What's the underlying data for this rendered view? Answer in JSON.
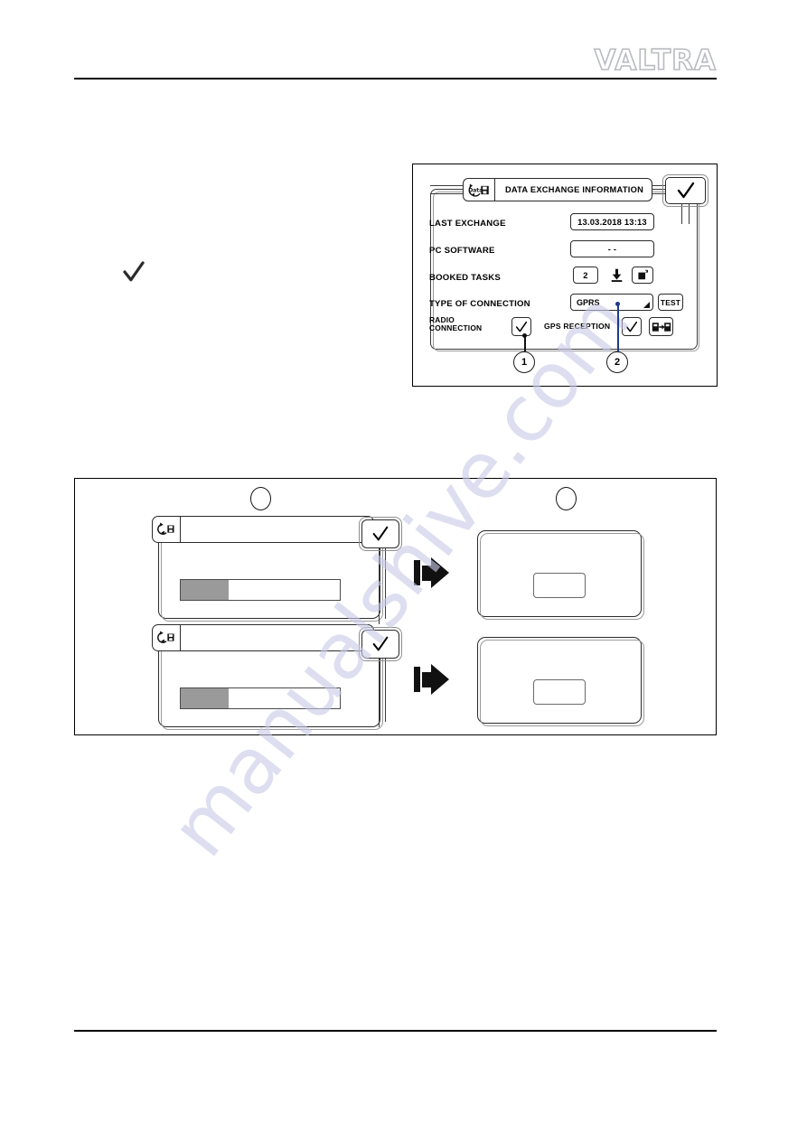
{
  "page": {
    "brand": "VALTRA",
    "brand_parts": {
      "v": "V",
      "a1": "A",
      "l": "L",
      "t": "T",
      "r": "R",
      "a2": "A"
    }
  },
  "figure1": {
    "title": "DATA EXCHANGE INFORMATION",
    "title_icon": "data-exchange-icon",
    "title_icon_label": "Data",
    "confirm_icon": "check-icon",
    "rows": [
      {
        "label": "LAST EXCHANGE",
        "value": "13.03.2018  13:13"
      },
      {
        "label": "PC SOFTWARE",
        "value": "- -"
      },
      {
        "label": "BOOKED TASKS",
        "value": "2"
      },
      {
        "label": "TYPE OF CONNECTION",
        "value": "GPRS"
      }
    ],
    "booked_tasks": {
      "count": "2",
      "download_icon": "download-icon",
      "delete_icon": "delete-icon"
    },
    "connection": {
      "selected": "GPRS",
      "options": [
        "GPRS"
      ],
      "test_label": "TEST",
      "dropdown_icon": "chevron-corner-icon"
    },
    "radio_connection": {
      "label_line1": "RADIO",
      "label_line2": "CONNECTION",
      "icon": "check-icon"
    },
    "gps_reception": {
      "label": "GPS RECEPTION",
      "icon": "check-icon",
      "transfer_icon": "data-transfer-icon"
    },
    "callouts": [
      {
        "number": "1"
      },
      {
        "number": "2"
      }
    ]
  },
  "figure2": {
    "step_markers": [
      "",
      ""
    ],
    "rows": [
      {
        "panel_icon": "sync-icon",
        "progress_percent": 30,
        "confirm_icon": "check-icon",
        "arrow_icon": "arrow-right-icon",
        "result_icon": "empty-field-icon"
      },
      {
        "panel_icon": "sync-icon",
        "progress_percent": 30,
        "confirm_icon": "check-icon",
        "arrow_icon": "arrow-right-icon",
        "result_icon": "empty-field-icon"
      }
    ]
  },
  "watermark": {
    "text": "manualshive.com"
  },
  "colors": {
    "ink": "#000000",
    "frame": "#2b2b2b",
    "progress_fill": "#9a9a9a",
    "watermark": "#c9cbe8",
    "logo_outline": "#b9bbc0"
  }
}
